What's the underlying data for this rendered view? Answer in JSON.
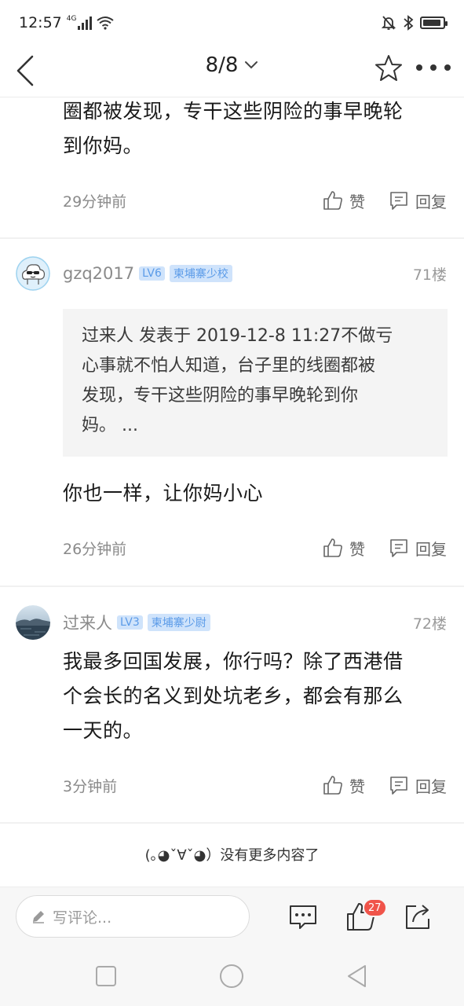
{
  "status_bar": {
    "time": "12:57",
    "network": "4G"
  },
  "nav": {
    "page_indicator": "8/8"
  },
  "top_fragment": {
    "text_line1": "圈都被发现，专干这些阴险的事早晚轮",
    "text_line2": "到你妈。",
    "time": "29分钟前"
  },
  "actions": {
    "like_label": "赞",
    "reply_label": "回复"
  },
  "comments": [
    {
      "username": "gzq2017",
      "level": "LV6",
      "rank": "柬埔寨少校",
      "floor": "71楼",
      "quote": {
        "line1": "过来人 发表于 2019-12-8 11:27不做亏",
        "line2": "心事就不怕人知道，台子里的线圈都被",
        "line3": "发现，专干这些阴险的事早晚轮到你",
        "line4": "妈。 ..."
      },
      "text_line1": "你也一样，让你妈小心",
      "time": "26分钟前"
    },
    {
      "username": "过来人",
      "level": "LV3",
      "rank": "柬埔寨少尉",
      "floor": "72楼",
      "text_line1": "我最多回国发展，你行吗？除了西港借",
      "text_line2": "个会长的名义到处坑老乡，都会有那么",
      "text_line3": "一天的。",
      "time": "3分钟前"
    }
  ],
  "end_message": "(｡◕ˇ∀ˇ◕）没有更多内容了",
  "bottom_bar": {
    "input_placeholder": "写评论...",
    "like_count": "27"
  },
  "colors": {
    "badge_bg": "#cfe3fb",
    "badge_text": "#5b9be8",
    "like_badge": "#f0544a"
  }
}
